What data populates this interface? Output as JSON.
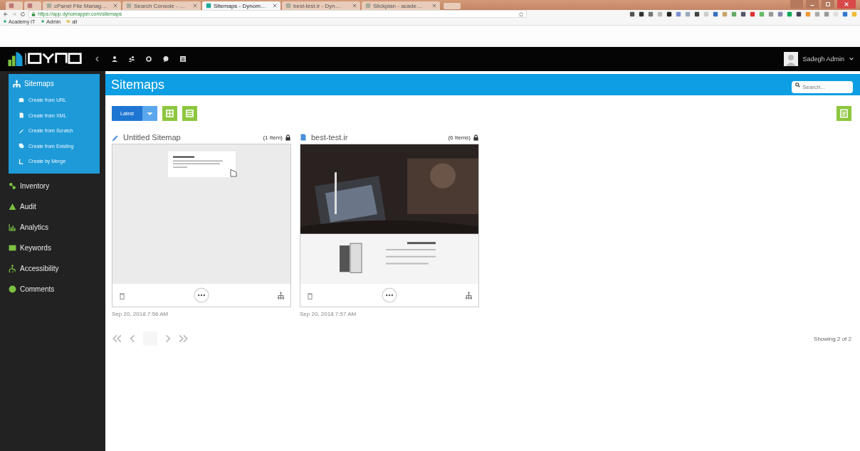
{
  "browser": {
    "tabs": [
      {
        "kind": "pinned",
        "selected": false
      },
      {
        "kind": "pinned",
        "selected": false
      },
      {
        "kind": "page",
        "title": "cPanel File Manag…",
        "selected": false
      },
      {
        "kind": "page",
        "title": "Search Console - …",
        "selected": false
      },
      {
        "kind": "page",
        "title": "Sitemaps - Dynom…",
        "selected": true
      },
      {
        "kind": "page",
        "title": "best-test.ir - Dyn…",
        "selected": false
      },
      {
        "kind": "page",
        "title": "Slickplan - acade…",
        "selected": false
      }
    ],
    "address": "https://app.dynomapper.com/sitemaps",
    "bookmarks": [
      "Academy IT",
      "Admin",
      "all"
    ]
  },
  "header": {
    "user": "Sadegh Admin"
  },
  "title_bar": {
    "title": "Sitemaps",
    "search": {
      "placeholder": "Search..."
    }
  },
  "sidebar": {
    "items": [
      {
        "label": "Sitemaps",
        "selected": true,
        "expanded": true,
        "children": [
          "Create from URL",
          "Create from XML",
          "Create from Scratch",
          "Create from Existing",
          "Create by Merge"
        ]
      },
      {
        "label": "Inventory",
        "selected": false,
        "expanded": false
      },
      {
        "label": "Audit",
        "selected": false,
        "expanded": false
      },
      {
        "label": "Analytics",
        "selected": false,
        "expanded": false
      },
      {
        "label": "Keywords",
        "selected": false,
        "expanded": false
      },
      {
        "label": "Accessibility",
        "selected": false,
        "expanded": false
      },
      {
        "label": "Comments",
        "selected": false,
        "expanded": false
      }
    ]
  },
  "toolbar": {
    "sort": "Latest"
  },
  "sitemaps": [
    {
      "kind": "blank",
      "title": "Untitled Sitemap",
      "count": "(1 Item)",
      "date": "Sep 20, 2018 7:56 AM"
    },
    {
      "kind": "site",
      "title": "best-test.ir",
      "count": "(6 Items)",
      "date": "Sep 20, 2018 7:57 AM"
    }
  ],
  "status": "Showing 2 of 2"
}
